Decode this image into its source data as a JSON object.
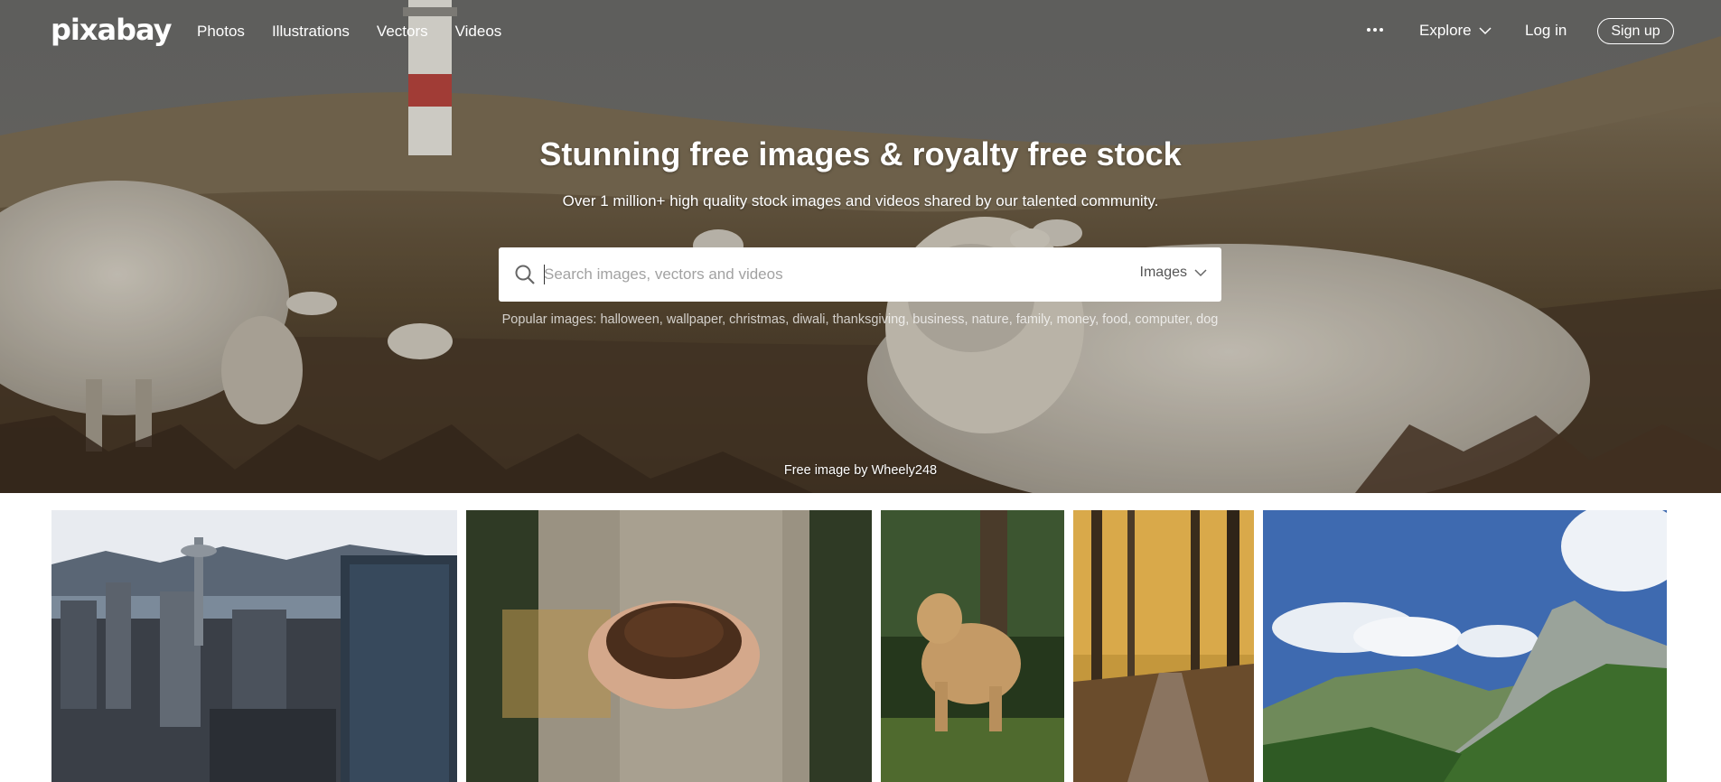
{
  "brand": {
    "logo_text": "pixabay"
  },
  "nav": {
    "links": [
      "Photos",
      "Illustrations",
      "Vectors",
      "Videos"
    ],
    "more_icon": "ellipsis-icon",
    "explore_label": "Explore",
    "login_label": "Log in",
    "signup_label": "Sign up"
  },
  "hero": {
    "title": "Stunning free images & royalty free stock",
    "subtitle": "Over 1 million+ high quality stock images and videos shared by our talented community.",
    "search": {
      "placeholder": "Search images, vectors and videos",
      "type_label": "Images"
    },
    "popular_prefix": "Popular images:",
    "popular_tags": [
      "halloween",
      "wallpaper",
      "christmas",
      "diwali",
      "thanksgiving",
      "business",
      "nature",
      "family",
      "money",
      "food",
      "computer",
      "dog"
    ],
    "credit_prefix": "Free image by",
    "credit_user": "Wheely248"
  },
  "colors": {
    "white": "#ffffff",
    "placeholder": "#a2a2a2"
  }
}
